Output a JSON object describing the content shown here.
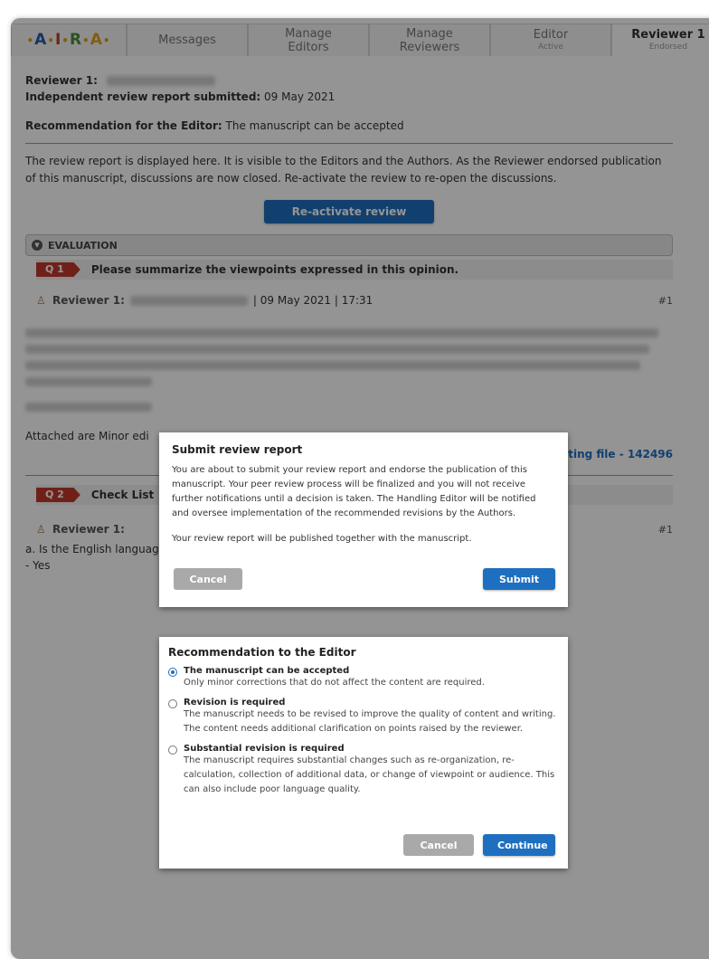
{
  "tabs": {
    "logo": "A R A",
    "messages": "Messages",
    "manage_editors_l1": "Manage",
    "manage_editors_l2": "Editors",
    "manage_reviewers_l1": "Manage",
    "manage_reviewers_l2": "Reviewers",
    "editor_label": "Editor",
    "editor_status": "Active",
    "reviewer_label": "Reviewer 1",
    "reviewer_status": "Endorsed"
  },
  "report": {
    "reviewer_label": "Reviewer 1:",
    "submitted_label": "Independent review report submitted:",
    "submitted_date": "09 May 2021",
    "recommendation_label": "Recommendation for the Editor:",
    "recommendation_value": "The manuscript can be accepted",
    "notice": "The review report is displayed here. It is visible to the Editors and the Authors. As the Reviewer endorsed publication of this manuscript, discussions are now closed. Re-activate the review to re-open the discussions.",
    "reactivate_button": "Re-activate review"
  },
  "evaluation": {
    "section_label": "EVALUATION",
    "q1_tag": "Q 1",
    "q1_text": "Please summarize the viewpoints expressed in this opinion.",
    "q1_reviewer": "Reviewer 1:",
    "q1_meta": "| 09 May 2021 | 17:31",
    "q1_hash": "#1",
    "attached_text": "Attached are Minor edi",
    "file_text": "ting file - 142496",
    "q2_tag": "Q 2",
    "q2_text": "Check List",
    "q2_reviewer": "Reviewer 1:",
    "q2_hash": "#1",
    "q2_question": "a. Is the English language of sufficient quality?",
    "q2_answer": "- Yes"
  },
  "submit_modal": {
    "title": "Submit review report",
    "body": "You are about to submit your review report and endorse the publication of this manuscript. Your peer review process will be finalized and you will not receive further notifications until a decision is taken. The Handling Editor will be notified and oversee implementation of the recommended revisions by the Authors.",
    "note": "Your review report will be published together with the manuscript.",
    "cancel": "Cancel",
    "submit": "Submit"
  },
  "recommendation_modal": {
    "title": "Recommendation to the Editor",
    "options": [
      {
        "title": "The manuscript can be accepted",
        "desc": "Only minor corrections that do not affect the content are required.",
        "checked": true
      },
      {
        "title": "Revision is required",
        "desc": "The manuscript needs to be revised to improve the quality of content and writing. The content needs additional clarification on points raised by the reviewer.",
        "checked": false
      },
      {
        "title": "Substantial revision is required",
        "desc": "The manuscript requires substantial changes such as re-organization, re-calculation, collection of additional data, or change of viewpoint or audience. This can also include poor language quality.",
        "checked": false
      }
    ],
    "cancel": "Cancel",
    "continue": "Continue"
  }
}
